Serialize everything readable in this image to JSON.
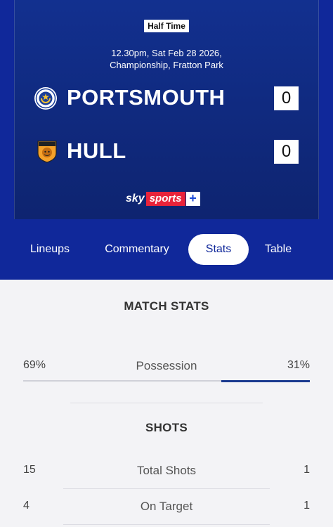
{
  "match": {
    "status": "Half Time",
    "datetime": "12.30pm, Sat Feb 28 2026,",
    "venue": "Championship, Fratton Park",
    "home": {
      "name": "PORTSMOUTH",
      "score": "0"
    },
    "away": {
      "name": "HULL",
      "score": "0"
    },
    "broadcaster": {
      "sky": "sky",
      "sports": "sports",
      "plus": "+"
    }
  },
  "tabs": [
    {
      "label": "Lineups",
      "active": false
    },
    {
      "label": "Commentary",
      "active": false
    },
    {
      "label": "Stats",
      "active": true
    },
    {
      "label": "Table",
      "active": false
    }
  ],
  "match_stats": {
    "title": "MATCH STATS",
    "possession": {
      "label": "Possession",
      "home": "69%",
      "away": "31%",
      "home_fraction": 0.69,
      "away_fraction": 0.31
    }
  },
  "shots": {
    "title": "SHOTS",
    "rows": [
      {
        "label": "Total Shots",
        "home": "15",
        "away": "1"
      },
      {
        "label": "On Target",
        "home": "4",
        "away": "1"
      }
    ]
  },
  "colors": {
    "primary": "#10289a",
    "away_bar": "#1a3a8f",
    "home_bar": "#cfd0d8",
    "sky_red": "#e8233a"
  }
}
